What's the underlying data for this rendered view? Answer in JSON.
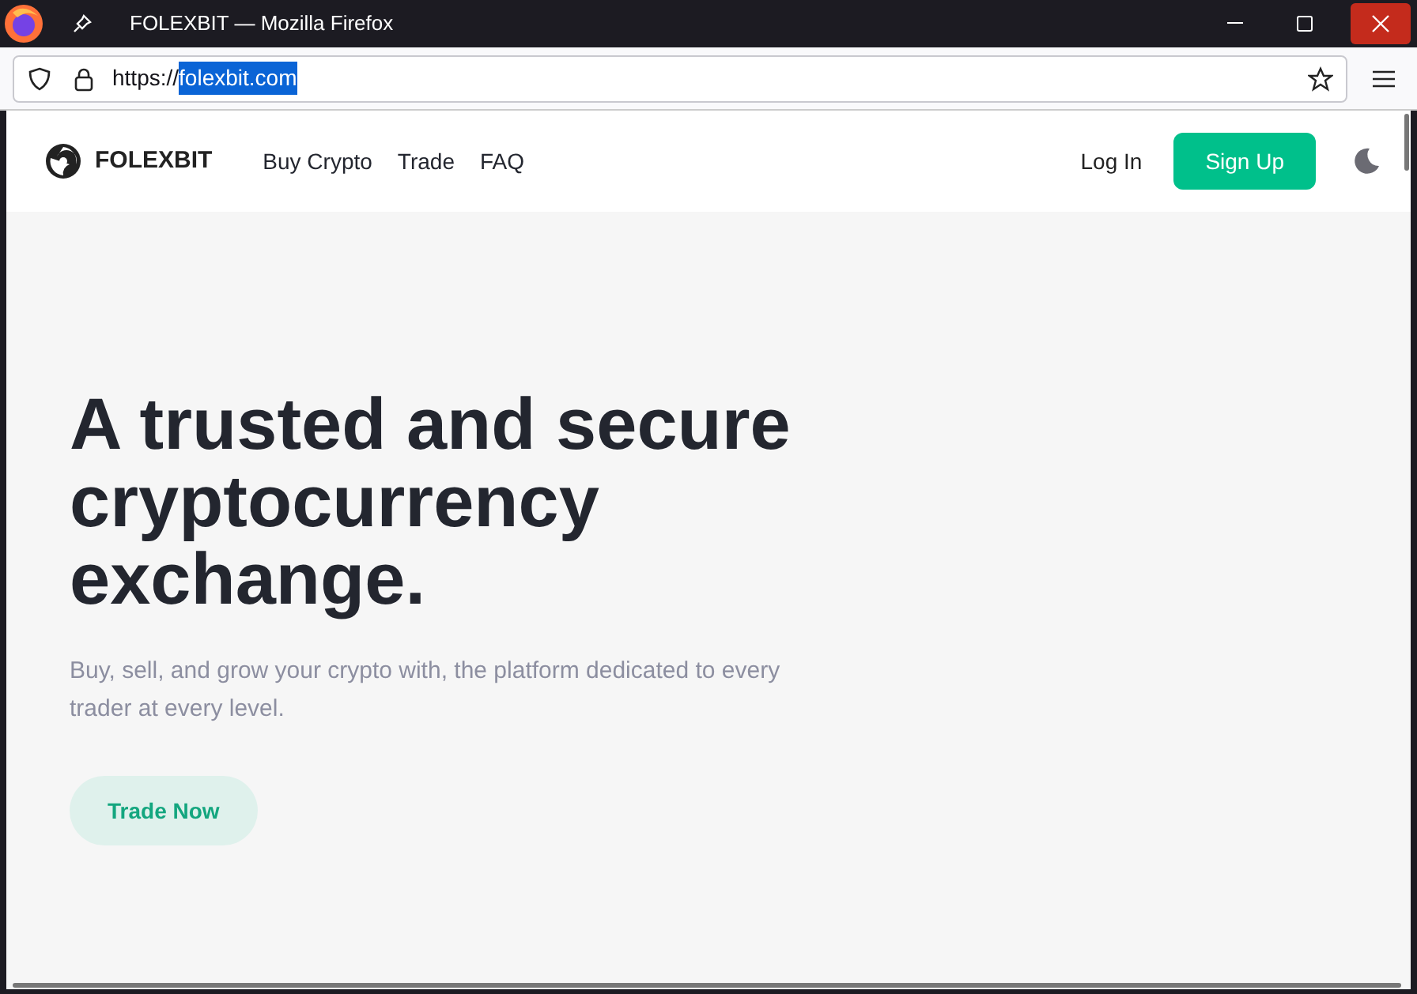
{
  "window": {
    "title": "FOLEXBIT — Mozilla Firefox"
  },
  "address_bar": {
    "prefix": "https://",
    "host": "folexbit.com",
    "host_selected": true
  },
  "nav": {
    "brand": "FOLEXBIT",
    "links": [
      "Buy Crypto",
      "Trade",
      "FAQ"
    ],
    "login": "Log In",
    "signup": "Sign Up"
  },
  "hero": {
    "headline": "A trusted and secure cryptocurrency exchange.",
    "subtitle": "Buy, sell, and grow your crypto with, the platform dedicated to every trader at every level.",
    "button": "Trade Now"
  }
}
